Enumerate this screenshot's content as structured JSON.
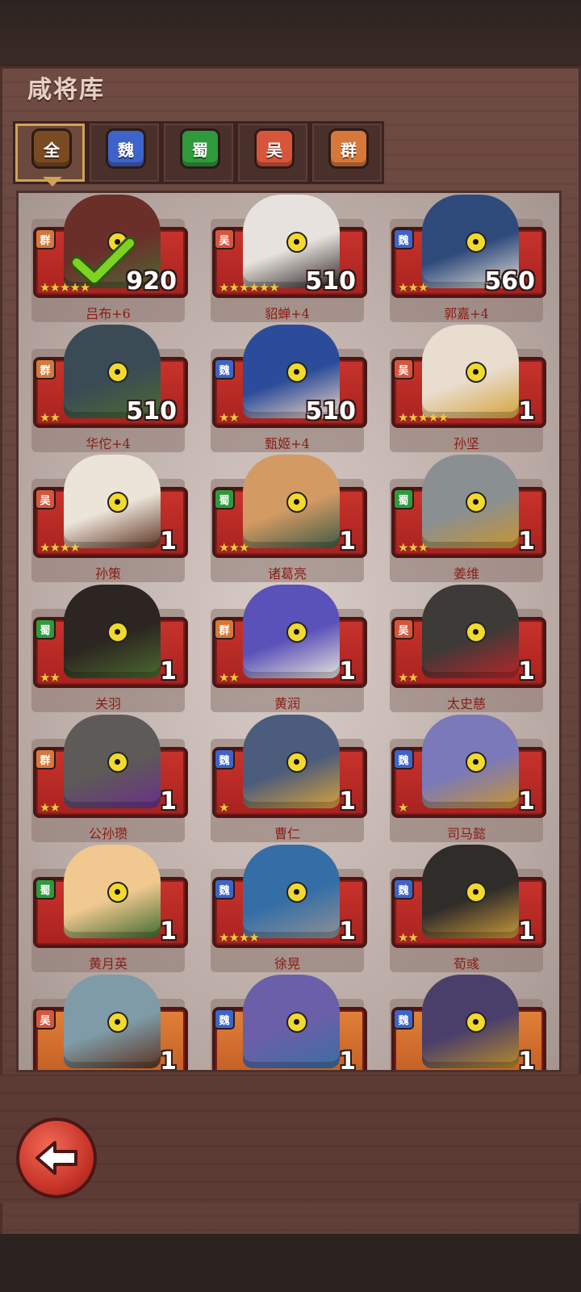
{
  "header": {
    "title": "咸将库"
  },
  "tabs": [
    {
      "label": "全",
      "color": "#7a4a22",
      "active": true
    },
    {
      "label": "魏",
      "color": "#3e63c9",
      "active": false
    },
    {
      "label": "蜀",
      "color": "#2f9a3b",
      "active": false
    },
    {
      "label": "吴",
      "color": "#d7553b",
      "active": false
    },
    {
      "label": "群",
      "color": "#d6783a",
      "active": false
    }
  ],
  "heroes": [
    {
      "name": "吕布+6",
      "faction": "群",
      "stars": 5,
      "count": "920",
      "selected": true,
      "skin": "#6b2f2a",
      "accent": "#4c6a35"
    },
    {
      "name": "貂蝉+4",
      "faction": "吴",
      "stars": 6,
      "count": "510",
      "selected": false,
      "skin": "#e7e2de",
      "accent": "#2a2222"
    },
    {
      "name": "郭嘉+4",
      "faction": "魏",
      "stars": 3,
      "count": "560",
      "selected": false,
      "skin": "#2e4a7a",
      "accent": "#e6e0d8"
    },
    {
      "name": "华佗+4",
      "faction": "群",
      "stars": 2,
      "count": "510",
      "selected": false,
      "skin": "#3b4b55",
      "accent": "#4d6a33"
    },
    {
      "name": "甄姬+4",
      "faction": "魏",
      "stars": 2,
      "count": "510",
      "selected": false,
      "skin": "#2b4c9a",
      "accent": "#f4d9c5"
    },
    {
      "name": "孙坚",
      "faction": "吴",
      "stars": 5,
      "count": "1",
      "selected": false,
      "skin": "#e9ddd0",
      "accent": "#d4a33a"
    },
    {
      "name": "孙策",
      "faction": "吴",
      "stars": 4,
      "count": "1",
      "selected": false,
      "skin": "#ede4d9",
      "accent": "#5a3320"
    },
    {
      "name": "诸葛亮",
      "faction": "蜀",
      "stars": 3,
      "count": "1",
      "selected": false,
      "skin": "#d39a64",
      "accent": "#3e5a45"
    },
    {
      "name": "姜维",
      "faction": "蜀",
      "stars": 3,
      "count": "1",
      "selected": false,
      "skin": "#8a8f92",
      "accent": "#c7952e"
    },
    {
      "name": "关羽",
      "faction": "蜀",
      "stars": 2,
      "count": "1",
      "selected": false,
      "skin": "#2c2521",
      "accent": "#4b6a2f"
    },
    {
      "name": "黄润",
      "faction": "群",
      "stars": 2,
      "count": "1",
      "selected": false,
      "skin": "#5a52b8",
      "accent": "#e8e3dc"
    },
    {
      "name": "太史慈",
      "faction": "吴",
      "stars": 2,
      "count": "1",
      "selected": false,
      "skin": "#3d3a38",
      "accent": "#b8262a"
    },
    {
      "name": "公孙瓒",
      "faction": "群",
      "stars": 2,
      "count": "1",
      "selected": false,
      "skin": "#5d5a57",
      "accent": "#6c2f8a"
    },
    {
      "name": "曹仁",
      "faction": "魏",
      "stars": 1,
      "count": "1",
      "selected": false,
      "skin": "#4b5c7c",
      "accent": "#d8a13a"
    },
    {
      "name": "司马懿",
      "faction": "魏",
      "stars": 1,
      "count": "1",
      "selected": false,
      "skin": "#7a79b9",
      "accent": "#c9942f"
    },
    {
      "name": "黄月英",
      "faction": "蜀",
      "stars": 0,
      "count": "1",
      "selected": false,
      "skin": "#f0c890",
      "accent": "#3f6b2e"
    },
    {
      "name": "徐晃",
      "faction": "魏",
      "stars": 4,
      "count": "1",
      "selected": false,
      "skin": "#356ea6",
      "accent": "#8f9195"
    },
    {
      "name": "荀彧",
      "faction": "魏",
      "stars": 2,
      "count": "1",
      "selected": false,
      "skin": "#2f2c2a",
      "accent": "#c99a3a"
    },
    {
      "name": "",
      "faction": "吴",
      "stars": 0,
      "count": "1",
      "selected": false,
      "skin": "#7f9ba8",
      "accent": "#5a3320",
      "orange": true
    },
    {
      "name": "",
      "faction": "魏",
      "stars": 0,
      "count": "1",
      "selected": false,
      "skin": "#6a5fa8",
      "accent": "#3b6fa1",
      "orange": true
    },
    {
      "name": "",
      "faction": "魏",
      "stars": 0,
      "count": "1",
      "selected": false,
      "skin": "#4a3f6a",
      "accent": "#b88a2a",
      "orange": true
    }
  ],
  "faction_colors": {
    "魏": "#3e63c9",
    "蜀": "#2f9a3b",
    "吴": "#d7553b",
    "群": "#d6783a"
  },
  "back_button": {
    "icon": "back-arrow-icon"
  }
}
